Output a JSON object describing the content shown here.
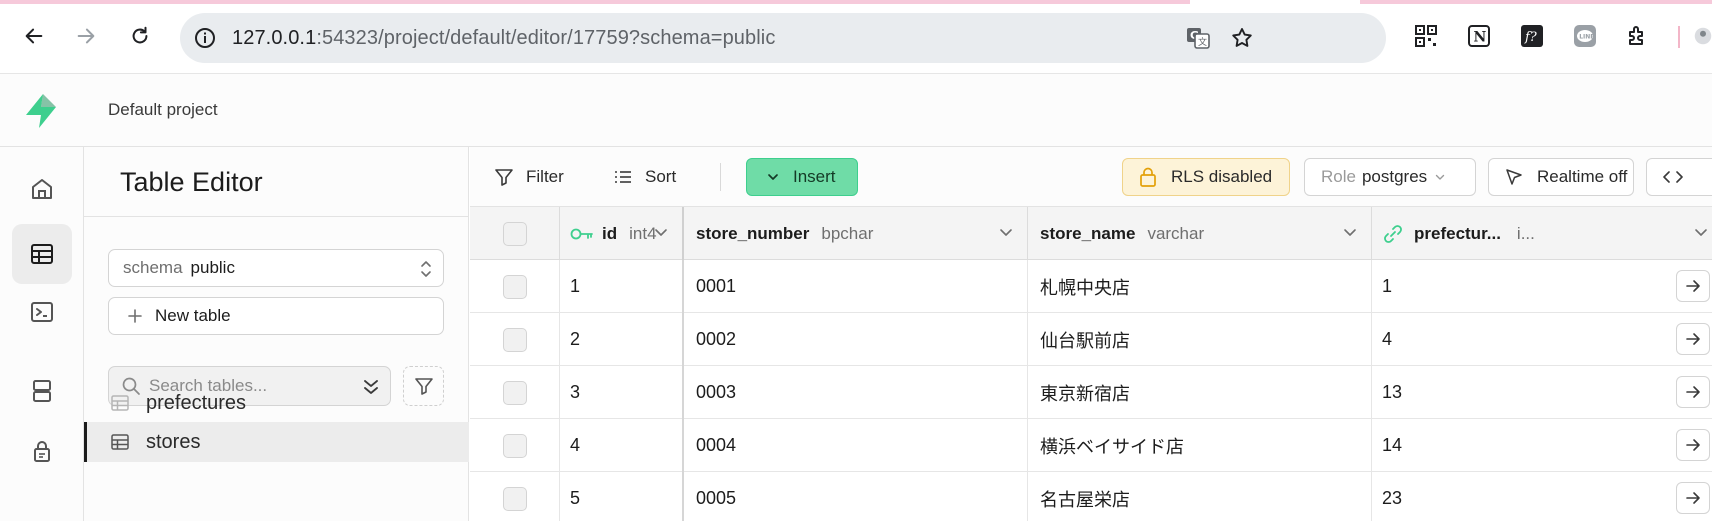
{
  "browser": {
    "url_host": "127.0.0.1",
    "url_rest": ":54323/project/default/editor/17759?schema=public"
  },
  "app": {
    "project_name": "Default project"
  },
  "sidebar": {
    "title": "Table Editor",
    "schema_label": "schema",
    "schema_value": "public",
    "new_table_label": "New table",
    "search_placeholder": "Search tables...",
    "tables": [
      {
        "name": "prefectures",
        "active": false
      },
      {
        "name": "stores",
        "active": true
      }
    ]
  },
  "toolbar": {
    "filter_label": "Filter",
    "sort_label": "Sort",
    "insert_label": "Insert",
    "rls_label": "RLS disabled",
    "role_label": "Role",
    "role_value": "postgres",
    "realtime_label": "Realtime off"
  },
  "grid": {
    "columns": [
      {
        "name": "id",
        "type": "int4"
      },
      {
        "name": "store_number",
        "type": "bpchar"
      },
      {
        "name": "store_name",
        "type": "varchar"
      },
      {
        "name": "prefectur...",
        "type": "i..."
      }
    ],
    "rows": [
      [
        "1",
        "0001",
        "札幌中央店",
        "1"
      ],
      [
        "2",
        "0002",
        "仙台駅前店",
        "4"
      ],
      [
        "3",
        "0003",
        "東京新宿店",
        "13"
      ],
      [
        "4",
        "0004",
        "横浜ベイサイド店",
        "14"
      ],
      [
        "5",
        "0005",
        "名古屋栄店",
        "23"
      ]
    ]
  },
  "colors": {
    "brand": "#3ecf8e",
    "insert_bg": "#6fdca7",
    "rls_bg": "#fdf3d8",
    "rls_icon": "#e3a008"
  },
  "icons": {
    "back": "arrow-left-icon",
    "forward": "arrow-right-icon",
    "reload": "reload-icon",
    "site_info": "site-info-icon",
    "translate": "translate-icon",
    "bookmark": "star-icon",
    "filter": "filter-icon",
    "sort": "sort-icon",
    "lock": "lock-icon",
    "realtime": "cursor-icon",
    "api": "code-icon",
    "key": "key-icon",
    "link": "link-icon"
  }
}
